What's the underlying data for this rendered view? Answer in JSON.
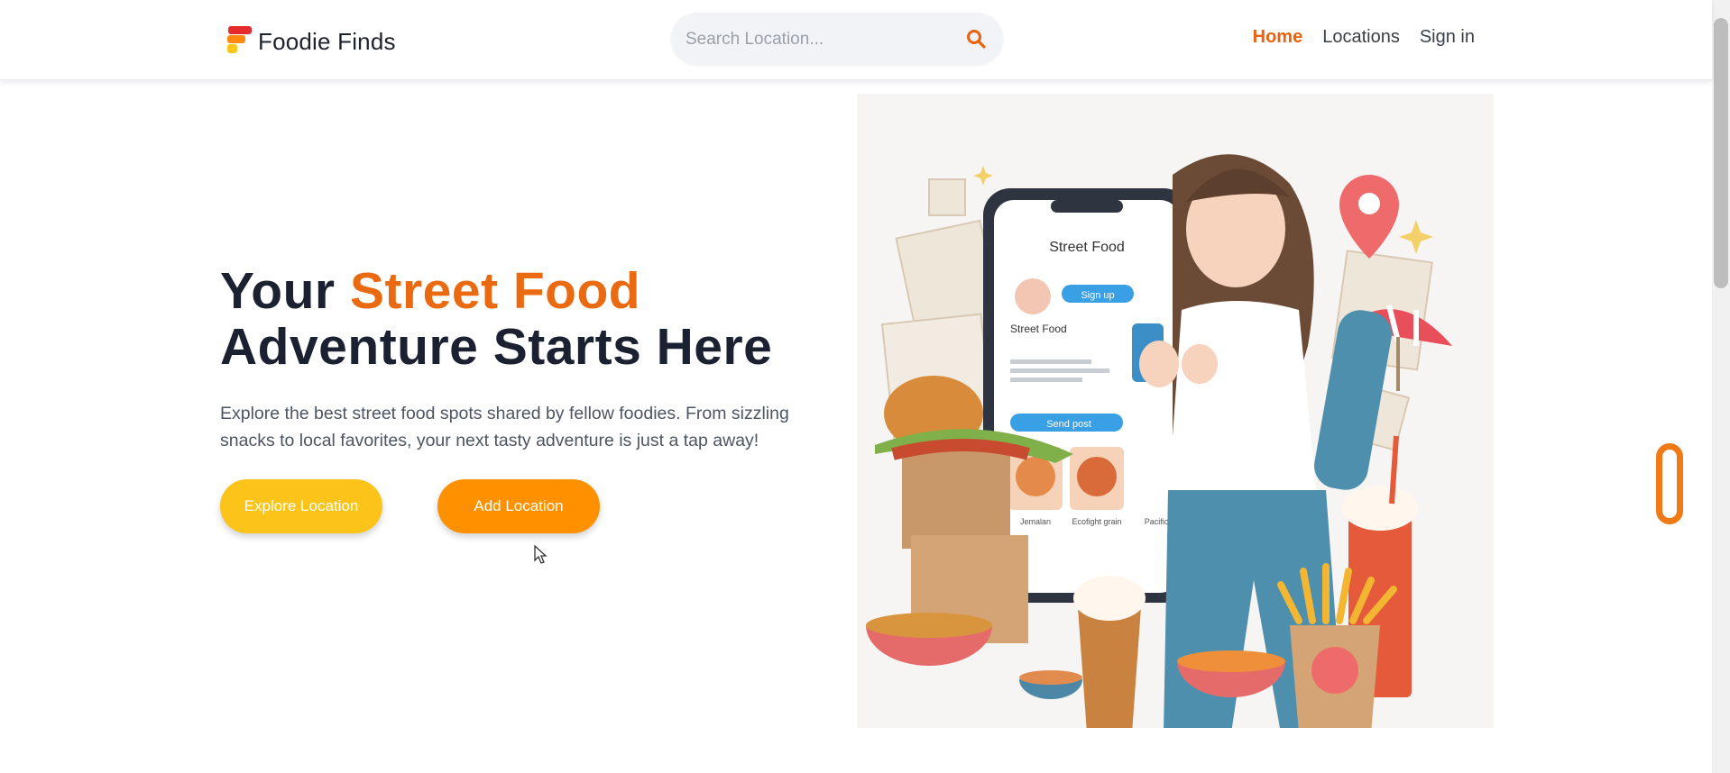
{
  "brand": {
    "name": "Foodie Finds",
    "colors": {
      "accent": "#ea6a12",
      "red": "#e52b2b",
      "orange": "#ff8a0f",
      "yellow": "#ffc61a"
    }
  },
  "search": {
    "placeholder": "Search Location...",
    "icon": "search-icon"
  },
  "nav": {
    "items": [
      {
        "label": "Home",
        "active": true
      },
      {
        "label": "Locations",
        "active": false
      },
      {
        "label": "Sign in",
        "active": false
      }
    ]
  },
  "hero": {
    "title_part1": "Your ",
    "title_highlight": "Street Food",
    "title_part2": "Adventure Starts Here",
    "description": "Explore the best street food spots shared by fellow foodies. From sizzling snacks to local favorites, your next tasty adventure is just a tap away!",
    "buttons": {
      "explore": "Explore Location",
      "add": "Add Location"
    },
    "illustration": {
      "phone_title": "Street Food",
      "phone_button": "Sign up",
      "phone_card_title": "Street Food",
      "phone_cta": "Send post",
      "phone_items": [
        "Jemalan",
        "Ecofight grain",
        "Pacific"
      ]
    }
  }
}
